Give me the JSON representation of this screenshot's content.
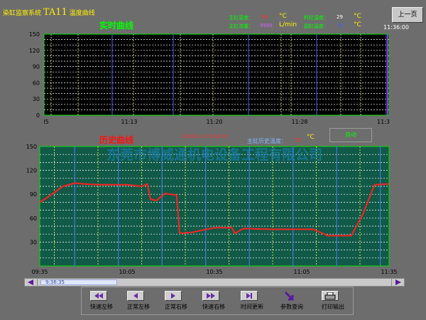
{
  "header": {
    "app_title_cn": "染缸监察系统",
    "app_title_model": "TA11",
    "app_title_suffix": "温度曲线",
    "prev_page_label": "上一页",
    "clock": "11:36:00"
  },
  "readouts": {
    "main_temp": {
      "label": "主缸温度：",
      "value": "98",
      "unit": "°C"
    },
    "material_temp": {
      "label": "料缸温度：",
      "value": "29",
      "unit": "°C"
    },
    "main_flow": {
      "label": "主缸流量：",
      "value": "9999",
      "unit": "L/min"
    },
    "aux_temp": {
      "label": "副缸温度：",
      "value": "78",
      "unit": "°C"
    }
  },
  "realtime": {
    "title": "实时曲线",
    "chart_data": {
      "type": "line",
      "y_ticks": [
        "150",
        "120",
        "90",
        "60",
        "30",
        "0"
      ],
      "x_ticks": [
        "I5",
        "11:13",
        "11:20",
        "11:28",
        "11:3"
      ],
      "ylim": [
        0,
        150
      ],
      "series": [],
      "grid": true
    }
  },
  "history": {
    "title": "历史曲线",
    "datetime": "2009-11-2 9:36:35",
    "temp_label": "主缸历史温度：",
    "temp_value": "73",
    "temp_unit": "°C",
    "auto_button": "自动",
    "watermark": "东莞市博威通机电设备工程有限公司",
    "chart_data": {
      "type": "line",
      "y_ticks": [
        "150",
        "120",
        "90",
        "60",
        "30"
      ],
      "x_ticks": [
        "09:35",
        "10:05",
        "10:35",
        "11:05",
        "11:35"
      ],
      "ylim": [
        0,
        150
      ],
      "xlim": [
        "09:35",
        "11:35"
      ],
      "grid": true,
      "series": [
        {
          "color": "#ff2020",
          "x": [
            "09:35",
            "09:38",
            "09:43",
            "09:47",
            "09:50",
            "09:55",
            "10:00",
            "10:05",
            "10:10",
            "10:12",
            "10:13",
            "10:15",
            "10:18",
            "10:22",
            "10:23",
            "10:24",
            "10:26",
            "10:27",
            "10:35",
            "10:37",
            "10:41",
            "10:42",
            "10:45",
            "10:55",
            "11:05",
            "11:09",
            "11:14",
            "11:22",
            "11:26",
            "11:30",
            "11:35"
          ],
          "values": [
            80,
            87,
            100,
            104,
            103,
            102,
            102,
            102,
            100,
            103,
            84,
            82,
            91,
            89,
            42,
            41,
            42,
            42,
            48,
            48,
            48,
            41,
            47,
            46,
            46,
            46,
            38,
            38,
            65,
            102,
            103
          ]
        }
      ]
    }
  },
  "scrollbar": {
    "thumb_label": "9:36:35"
  },
  "toolbar": {
    "fast_left": "快速左移",
    "normal_left": "正常左移",
    "normal_right": "正常右移",
    "fast_right": "快速右移",
    "time_update": "时间更新",
    "param_query": "参数查询",
    "print_output": "打印输出"
  },
  "colors": {
    "plot_bg_realtime": "#000000",
    "plot_bg_history": "#115a48",
    "accent": "#ffee00",
    "trend_line": "#ff2020"
  }
}
